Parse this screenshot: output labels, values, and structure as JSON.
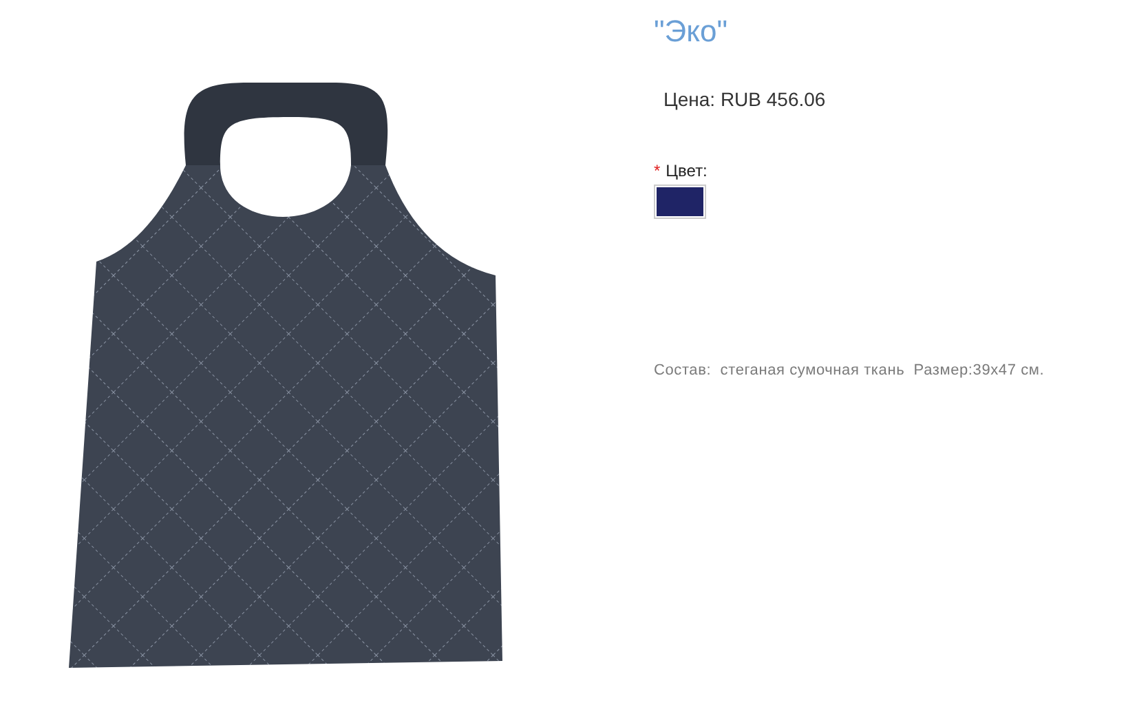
{
  "product": {
    "title": "\"Эко\"",
    "price": "Цена: RUB 456.06",
    "color_label": "Цвет:",
    "required_mark": "*",
    "color_options": [
      {
        "color": "#1f2466",
        "selected": true
      }
    ],
    "description": "Состав:  стеганая сумочная ткань  Размер:39x47 см."
  }
}
